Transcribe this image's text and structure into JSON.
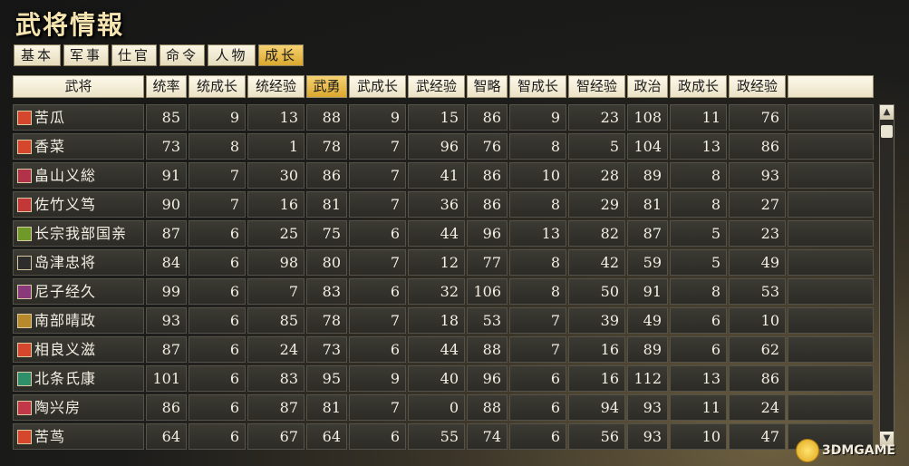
{
  "title": "武将情報",
  "tabs": [
    {
      "label": "基本",
      "active": false
    },
    {
      "label": "军事",
      "active": false
    },
    {
      "label": "仕官",
      "active": false
    },
    {
      "label": "命令",
      "active": false
    },
    {
      "label": "人物",
      "active": false
    },
    {
      "label": "成长",
      "active": true
    }
  ],
  "columns": [
    "武将",
    "统率",
    "统成长",
    "统经验",
    "武勇",
    "武成长",
    "武经验",
    "智略",
    "智成长",
    "智经验",
    "政治",
    "政成长",
    "政经验",
    ""
  ],
  "sorted_column": "武勇",
  "rows": [
    {
      "name": "苦瓜",
      "crest": "diamond-crest-icon",
      "crest_color": "#d6462c",
      "values": [
        85,
        9,
        13,
        88,
        9,
        15,
        86,
        9,
        23,
        108,
        11,
        76
      ]
    },
    {
      "name": "香菜",
      "crest": "diamond-crest-icon",
      "crest_color": "#d6462c",
      "values": [
        73,
        8,
        1,
        78,
        7,
        96,
        76,
        8,
        5,
        104,
        13,
        86
      ]
    },
    {
      "name": "畠山义総",
      "crest": "checker-crest-icon",
      "crest_color": "#b2324a",
      "values": [
        91,
        7,
        30,
        86,
        7,
        41,
        86,
        10,
        28,
        89,
        8,
        93
      ]
    },
    {
      "name": "佐竹义笃",
      "crest": "eye-crest-icon",
      "crest_color": "#c23838",
      "values": [
        90,
        7,
        16,
        81,
        7,
        36,
        86,
        8,
        29,
        81,
        8,
        27
      ]
    },
    {
      "name": "长宗我部国亲",
      "crest": "flower-crest-icon",
      "crest_color": "#6f9a2a",
      "values": [
        87,
        6,
        25,
        75,
        6,
        44,
        96,
        13,
        82,
        87,
        5,
        23
      ]
    },
    {
      "name": "岛津忠将",
      "crest": "cross-circle-crest-icon",
      "crest_color": "#2d2d2d",
      "values": [
        84,
        6,
        98,
        80,
        7,
        12,
        77,
        8,
        42,
        59,
        5,
        49
      ]
    },
    {
      "name": "尼子经久",
      "crest": "grid-crest-icon",
      "crest_color": "#8a3a7a",
      "values": [
        99,
        6,
        7,
        83,
        6,
        32,
        106,
        8,
        50,
        91,
        8,
        53
      ]
    },
    {
      "name": "南部晴政",
      "crest": "coin-crest-icon",
      "crest_color": "#b8892a",
      "values": [
        93,
        6,
        85,
        78,
        7,
        18,
        53,
        7,
        39,
        49,
        6,
        10
      ]
    },
    {
      "name": "相良义滋",
      "crest": "blossom-crest-icon",
      "crest_color": "#d6462c",
      "values": [
        87,
        6,
        24,
        73,
        6,
        44,
        88,
        7,
        16,
        89,
        6,
        62
      ]
    },
    {
      "name": "北条氏康",
      "crest": "triangle-crest-icon",
      "crest_color": "#2f8f6a",
      "values": [
        101,
        6,
        83,
        95,
        9,
        40,
        96,
        6,
        16,
        112,
        13,
        86
      ]
    },
    {
      "name": "陶兴房",
      "crest": "diamond-crest-icon",
      "crest_color": "#c23848",
      "values": [
        86,
        6,
        87,
        81,
        7,
        0,
        88,
        6,
        94,
        93,
        11,
        24
      ]
    },
    {
      "name": "苦茑",
      "crest": "diamond-crest-icon",
      "crest_color": "#d6462c",
      "values": [
        64,
        6,
        67,
        64,
        6,
        55,
        74,
        6,
        56,
        93,
        10,
        47
      ]
    }
  ],
  "scroll": {
    "up_icon": "scroll-up-icon",
    "down_icon": "scroll-down-icon",
    "position": 0.0
  },
  "watermark": {
    "text": "3DMGAME"
  }
}
